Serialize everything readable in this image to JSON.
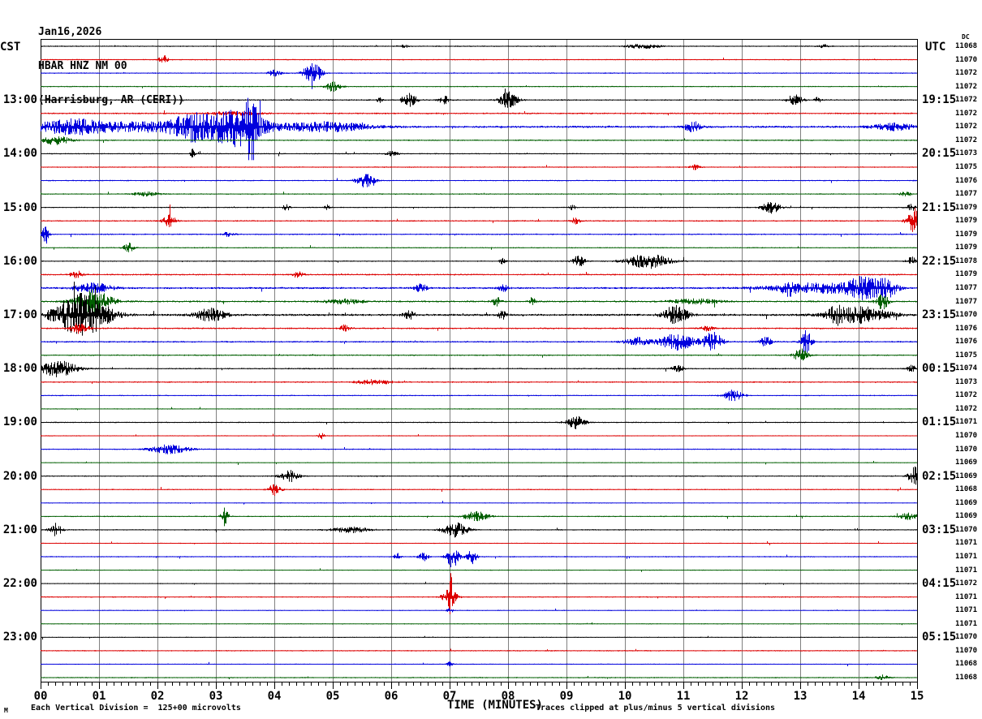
{
  "header": {
    "date": "Jan16,2026",
    "station": "HBAR HNZ NM 00",
    "location": "(Harrisburg, AR (CERI))"
  },
  "axes": {
    "left_header": "CST",
    "right_header": "UTC",
    "dc_header": "DC",
    "x_title": "TIME (MINUTES)",
    "x_ticks": [
      "00",
      "01",
      "02",
      "03",
      "04",
      "05",
      "06",
      "07",
      "08",
      "09",
      "10",
      "11",
      "12",
      "13",
      "14",
      "15"
    ]
  },
  "footer": {
    "corner_mark": "M",
    "scale_note": "Each Vertical Division =  125+00 microvolts",
    "clip_note": "Traces clipped at plus/minus 5 vertical divisions"
  },
  "chart_data": {
    "type": "line",
    "subtype": "helicorder-seismogram",
    "title": "HBAR HNZ NM 00 (Harrisburg, AR (CERI)) Jan16,2026",
    "xlabel": "TIME (MINUTES)",
    "x_range": [
      0,
      15
    ],
    "minutes_per_line": 15,
    "clip_divisions": 5,
    "microvolts_per_division": 125.0,
    "grid": true,
    "colors": {
      "black": "#000000",
      "red": "#dd0000",
      "blue": "#0000dd",
      "green": "#005f00",
      "grid": "#808080"
    },
    "color_cycle": [
      "black",
      "red",
      "blue",
      "green"
    ],
    "rows": [
      {
        "color": "black",
        "cst": "",
        "utc": "",
        "dc": "11068",
        "noise": 0.8,
        "events": [
          [
            10.3,
            0.25,
            3
          ],
          [
            6.2,
            0.08,
            2
          ],
          [
            13.4,
            0.08,
            2
          ]
        ]
      },
      {
        "color": "red",
        "cst": "",
        "utc": "",
        "dc": "11070",
        "noise": 0.8,
        "events": [
          [
            2.1,
            0.08,
            5
          ]
        ]
      },
      {
        "color": "blue",
        "cst": "",
        "utc": "",
        "dc": "11072",
        "noise": 0.8,
        "events": [
          [
            4.65,
            0.15,
            13
          ],
          [
            4.0,
            0.1,
            4
          ]
        ]
      },
      {
        "color": "green",
        "cst": "",
        "utc": "",
        "dc": "11072",
        "noise": 0.8,
        "events": [
          [
            5.0,
            0.12,
            6
          ]
        ]
      },
      {
        "color": "black",
        "cst": "13:00",
        "utc": "19:15",
        "dc": "11072",
        "noise": 0.9,
        "events": [
          [
            6.3,
            0.12,
            9
          ],
          [
            6.9,
            0.08,
            5
          ],
          [
            8.0,
            0.15,
            10
          ],
          [
            12.9,
            0.12,
            7
          ],
          [
            5.8,
            0.05,
            3
          ],
          [
            13.3,
            0.06,
            4
          ]
        ]
      },
      {
        "color": "red",
        "cst": "",
        "utc": "",
        "dc": "11072",
        "noise": 1.0,
        "events": [
          [
            3.3,
            0.4,
            2
          ]
        ]
      },
      {
        "color": "blue",
        "cst": "",
        "utc": "",
        "dc": "11072",
        "noise": 1.3,
        "events": [
          [
            2.0,
            2.0,
            6
          ],
          [
            0.5,
            0.5,
            6
          ],
          [
            3.35,
            0.4,
            22
          ],
          [
            3.6,
            0.08,
            40
          ],
          [
            2.6,
            0.3,
            12
          ],
          [
            4.9,
            0.7,
            5
          ],
          [
            11.15,
            0.12,
            7
          ],
          [
            14.6,
            0.35,
            4
          ]
        ]
      },
      {
        "color": "green",
        "cst": "",
        "utc": "",
        "dc": "11072",
        "noise": 0.9,
        "events": [
          [
            0.25,
            0.25,
            5
          ]
        ]
      },
      {
        "color": "black",
        "cst": "14:00",
        "utc": "20:15",
        "dc": "11073",
        "noise": 0.8,
        "events": [
          [
            2.6,
            0.04,
            6
          ],
          [
            6.0,
            0.1,
            3
          ]
        ]
      },
      {
        "color": "red",
        "cst": "",
        "utc": "",
        "dc": "11075",
        "noise": 0.8,
        "events": [
          [
            11.2,
            0.08,
            3
          ]
        ]
      },
      {
        "color": "blue",
        "cst": "",
        "utc": "",
        "dc": "11076",
        "noise": 0.8,
        "events": [
          [
            5.55,
            0.15,
            8
          ]
        ]
      },
      {
        "color": "green",
        "cst": "",
        "utc": "",
        "dc": "11077",
        "noise": 0.8,
        "events": [
          [
            1.8,
            0.2,
            2.5
          ],
          [
            14.8,
            0.1,
            2.5
          ]
        ]
      },
      {
        "color": "black",
        "cst": "15:00",
        "utc": "21:15",
        "dc": "11079",
        "noise": 0.8,
        "events": [
          [
            4.2,
            0.06,
            4
          ],
          [
            4.9,
            0.05,
            3
          ],
          [
            9.1,
            0.05,
            3
          ],
          [
            12.5,
            0.15,
            7
          ],
          [
            14.9,
            0.08,
            4
          ]
        ]
      },
      {
        "color": "red",
        "cst": "",
        "utc": "",
        "dc": "11079",
        "noise": 0.9,
        "events": [
          [
            2.2,
            0.1,
            8
          ],
          [
            9.15,
            0.07,
            4
          ],
          [
            14.95,
            0.12,
            14
          ]
        ]
      },
      {
        "color": "blue",
        "cst": "",
        "utc": "",
        "dc": "11079",
        "noise": 0.9,
        "events": [
          [
            0.08,
            0.05,
            12
          ],
          [
            3.2,
            0.1,
            3
          ]
        ]
      },
      {
        "color": "green",
        "cst": "",
        "utc": "",
        "dc": "11079",
        "noise": 0.8,
        "events": [
          [
            1.5,
            0.08,
            6
          ]
        ]
      },
      {
        "color": "black",
        "cst": "16:00",
        "utc": "22:15",
        "dc": "11078",
        "noise": 0.8,
        "events": [
          [
            7.9,
            0.05,
            4
          ],
          [
            9.2,
            0.1,
            7
          ],
          [
            10.4,
            0.35,
            9
          ],
          [
            14.9,
            0.08,
            5
          ]
        ]
      },
      {
        "color": "red",
        "cst": "",
        "utc": "",
        "dc": "11079",
        "noise": 1.0,
        "events": [
          [
            0.6,
            0.1,
            5
          ],
          [
            4.4,
            0.08,
            4
          ]
        ]
      },
      {
        "color": "blue",
        "cst": "",
        "utc": "",
        "dc": "11077",
        "noise": 1.2,
        "events": [
          [
            0.9,
            0.3,
            6
          ],
          [
            6.5,
            0.1,
            5
          ],
          [
            7.9,
            0.08,
            5
          ],
          [
            13.3,
            0.8,
            6
          ],
          [
            14.1,
            0.3,
            12
          ],
          [
            14.5,
            0.15,
            10
          ],
          [
            12.8,
            0.1,
            6
          ]
        ]
      },
      {
        "color": "green",
        "cst": "",
        "utc": "",
        "dc": "11077",
        "noise": 1.1,
        "events": [
          [
            0.9,
            0.3,
            14
          ],
          [
            7.8,
            0.07,
            6
          ],
          [
            8.4,
            0.06,
            5
          ],
          [
            14.4,
            0.1,
            10
          ],
          [
            5.2,
            0.3,
            3
          ],
          [
            11.2,
            0.4,
            3
          ]
        ]
      },
      {
        "color": "black",
        "cst": "17:00",
        "utc": "23:15",
        "dc": "11070",
        "noise": 1.3,
        "events": [
          [
            0.7,
            0.45,
            26
          ],
          [
            2.9,
            0.25,
            8
          ],
          [
            6.3,
            0.1,
            5
          ],
          [
            7.9,
            0.08,
            5
          ],
          [
            10.85,
            0.2,
            12
          ],
          [
            14.0,
            0.5,
            10
          ],
          [
            13.6,
            0.1,
            8
          ]
        ]
      },
      {
        "color": "red",
        "cst": "",
        "utc": "",
        "dc": "11076",
        "noise": 1.0,
        "events": [
          [
            0.65,
            0.15,
            7
          ],
          [
            5.2,
            0.1,
            4
          ],
          [
            11.4,
            0.1,
            3
          ]
        ]
      },
      {
        "color": "blue",
        "cst": "",
        "utc": "",
        "dc": "11076",
        "noise": 1.0,
        "events": [
          [
            10.9,
            0.3,
            10
          ],
          [
            11.5,
            0.15,
            12
          ],
          [
            13.1,
            0.08,
            16
          ],
          [
            12.4,
            0.1,
            6
          ],
          [
            10.2,
            0.2,
            5
          ]
        ]
      },
      {
        "color": "green",
        "cst": "",
        "utc": "",
        "dc": "11075",
        "noise": 0.9,
        "events": [
          [
            13.0,
            0.12,
            8
          ]
        ]
      },
      {
        "color": "black",
        "cst": "18:00",
        "utc": "00:15",
        "dc": "11074",
        "noise": 0.9,
        "events": [
          [
            0.3,
            0.3,
            10
          ],
          [
            10.9,
            0.1,
            4
          ],
          [
            14.9,
            0.07,
            4
          ]
        ]
      },
      {
        "color": "red",
        "cst": "",
        "utc": "",
        "dc": "11073",
        "noise": 0.9,
        "events": [
          [
            5.7,
            0.3,
            3
          ]
        ]
      },
      {
        "color": "blue",
        "cst": "",
        "utc": "",
        "dc": "11072",
        "noise": 0.8,
        "events": [
          [
            11.85,
            0.15,
            7
          ]
        ]
      },
      {
        "color": "green",
        "cst": "",
        "utc": "",
        "dc": "11072",
        "noise": 0.7,
        "events": []
      },
      {
        "color": "black",
        "cst": "19:00",
        "utc": "01:15",
        "dc": "11071",
        "noise": 0.8,
        "events": [
          [
            9.15,
            0.15,
            8
          ]
        ]
      },
      {
        "color": "red",
        "cst": "",
        "utc": "",
        "dc": "11070",
        "noise": 0.7,
        "events": [
          [
            4.8,
            0.05,
            4
          ]
        ]
      },
      {
        "color": "blue",
        "cst": "",
        "utc": "",
        "dc": "11070",
        "noise": 0.8,
        "events": [
          [
            2.2,
            0.3,
            6
          ]
        ]
      },
      {
        "color": "green",
        "cst": "",
        "utc": "",
        "dc": "11069",
        "noise": 0.7,
        "events": []
      },
      {
        "color": "black",
        "cst": "20:00",
        "utc": "02:15",
        "dc": "11069",
        "noise": 0.8,
        "events": [
          [
            4.25,
            0.15,
            7
          ],
          [
            14.95,
            0.1,
            12
          ]
        ]
      },
      {
        "color": "red",
        "cst": "",
        "utc": "",
        "dc": "11068",
        "noise": 0.8,
        "events": [
          [
            4.0,
            0.1,
            7
          ]
        ]
      },
      {
        "color": "blue",
        "cst": "",
        "utc": "",
        "dc": "11069",
        "noise": 0.7,
        "events": []
      },
      {
        "color": "green",
        "cst": "",
        "utc": "",
        "dc": "11069",
        "noise": 0.8,
        "events": [
          [
            3.15,
            0.06,
            12
          ],
          [
            7.45,
            0.2,
            6
          ],
          [
            14.85,
            0.15,
            4
          ]
        ]
      },
      {
        "color": "black",
        "cst": "21:00",
        "utc": "03:15",
        "dc": "11070",
        "noise": 0.8,
        "events": [
          [
            0.25,
            0.1,
            8
          ],
          [
            5.3,
            0.3,
            4
          ],
          [
            7.1,
            0.2,
            9
          ]
        ]
      },
      {
        "color": "red",
        "cst": "",
        "utc": "",
        "dc": "11071",
        "noise": 0.7,
        "events": []
      },
      {
        "color": "blue",
        "cst": "",
        "utc": "",
        "dc": "11071",
        "noise": 0.8,
        "events": [
          [
            6.1,
            0.05,
            4
          ],
          [
            6.55,
            0.08,
            5
          ],
          [
            7.05,
            0.1,
            14
          ],
          [
            7.37,
            0.08,
            9
          ]
        ]
      },
      {
        "color": "green",
        "cst": "",
        "utc": "",
        "dc": "11071",
        "noise": 0.7,
        "events": []
      },
      {
        "color": "black",
        "cst": "22:00",
        "utc": "04:15",
        "dc": "11072",
        "noise": 0.7,
        "events": []
      },
      {
        "color": "red",
        "cst": "",
        "utc": "",
        "dc": "11071",
        "noise": 0.8,
        "events": [
          [
            7.0,
            0.12,
            10
          ],
          [
            7.02,
            0.03,
            20
          ]
        ]
      },
      {
        "color": "blue",
        "cst": "",
        "utc": "",
        "dc": "11071",
        "noise": 0.7,
        "events": [
          [
            7.0,
            0.05,
            3
          ]
        ]
      },
      {
        "color": "green",
        "cst": "",
        "utc": "",
        "dc": "11071",
        "noise": 0.7,
        "events": []
      },
      {
        "color": "black",
        "cst": "23:00",
        "utc": "05:15",
        "dc": "11070",
        "noise": 0.7,
        "events": []
      },
      {
        "color": "red",
        "cst": "",
        "utc": "",
        "dc": "11070",
        "noise": 0.8,
        "events": []
      },
      {
        "color": "blue",
        "cst": "",
        "utc": "",
        "dc": "11068",
        "noise": 0.7,
        "events": [
          [
            7.0,
            0.05,
            3
          ]
        ]
      },
      {
        "color": "green",
        "cst": "",
        "utc": "",
        "dc": "11068",
        "noise": 0.8,
        "events": [
          [
            14.4,
            0.1,
            3
          ]
        ]
      }
    ]
  }
}
